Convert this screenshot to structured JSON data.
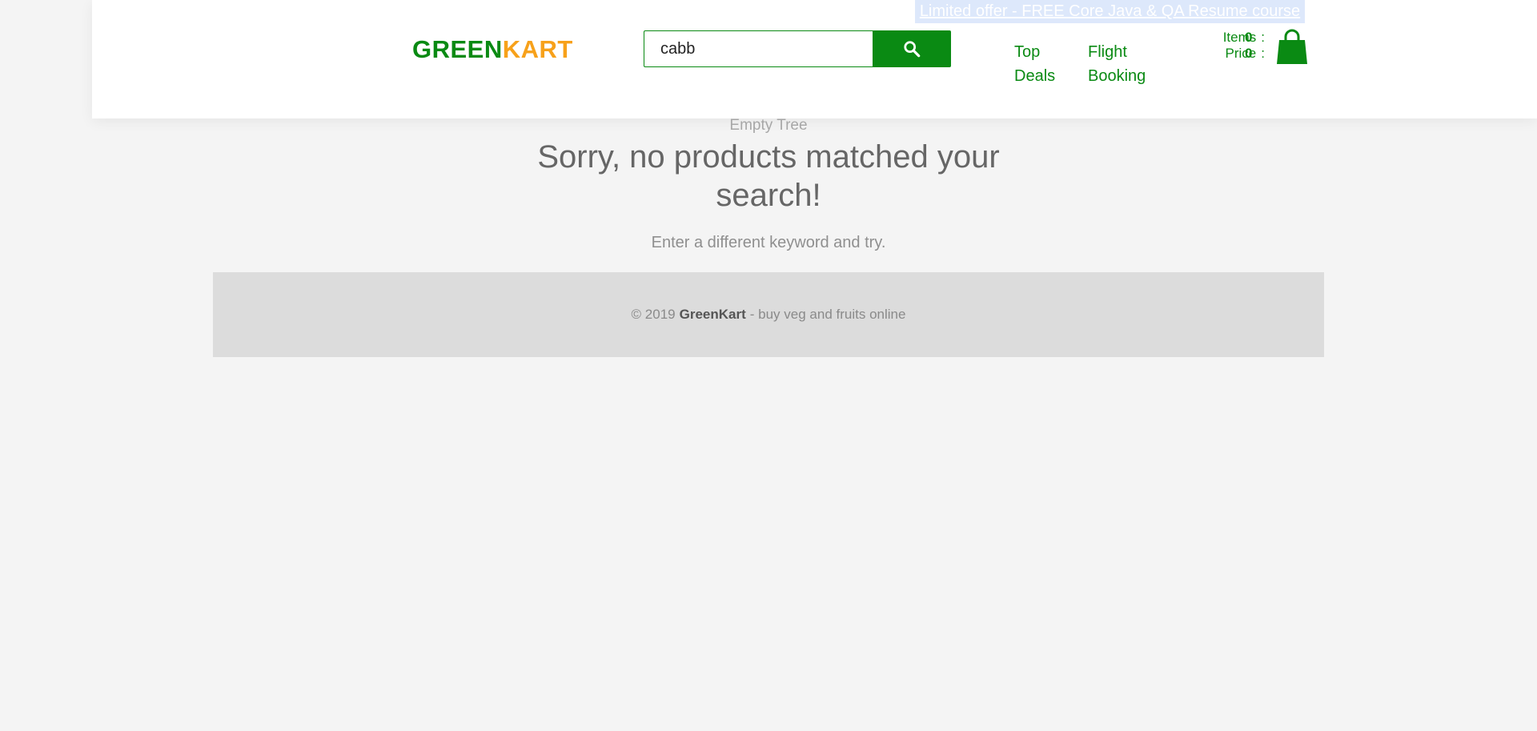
{
  "header": {
    "offer": "Limited offer - FREE Core Java & QA Resume course",
    "brand": {
      "part1": "GREEN",
      "part2": "KART",
      "color1": "#0a8a13",
      "color2": "#f7a11a"
    },
    "search": {
      "value": "cabb",
      "button_icon": "search-icon"
    },
    "nav": [
      {
        "label": "Top Deals"
      },
      {
        "label": "Flight Booking"
      }
    ],
    "cart": {
      "items_label": "Items",
      "price_label": "Price",
      "separator": ":",
      "items_value": "0",
      "price_value": "0",
      "icon": "shopping-bag-icon"
    }
  },
  "results": {
    "empty_image_alt": "Empty Tree",
    "message": "Sorry, no products matched your search!",
    "hint": "Enter a different keyword and try."
  },
  "footer": {
    "prefix": "© 2019",
    "brand": "GreenKart",
    "suffix": "- buy veg and fruits online"
  },
  "colors": {
    "accent": "#0a8a13",
    "accent_secondary": "#f7a11a",
    "background": "#f4f4f4"
  }
}
